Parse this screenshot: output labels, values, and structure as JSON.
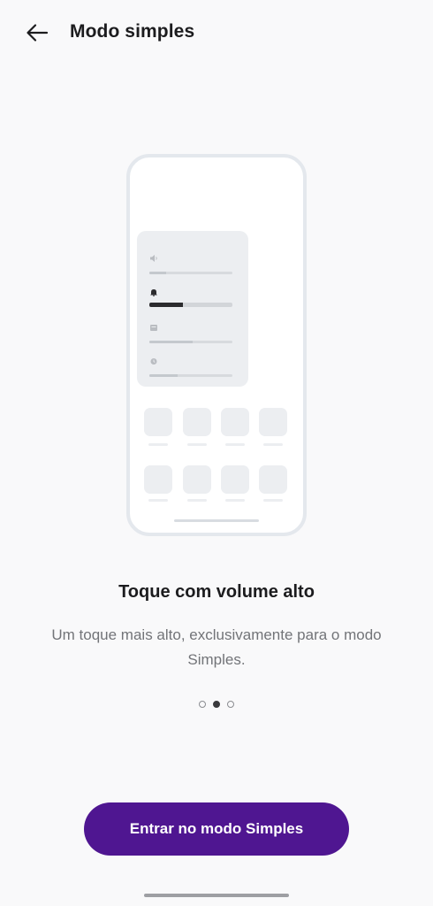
{
  "header": {
    "back_icon": "arrow-left-icon",
    "title": "Modo simples"
  },
  "illustration": {
    "volume_sliders": [
      {
        "icon": "speaker-icon",
        "level": 0.2
      },
      {
        "icon": "bell-icon",
        "level": 0.4,
        "active": true
      },
      {
        "icon": "notification-icon",
        "level": 0.52
      },
      {
        "icon": "alarm-clock-icon",
        "level": 0.34
      }
    ],
    "app_rows": 2,
    "apps_per_row": 4
  },
  "slide": {
    "title": "Toque com volume alto",
    "description": "Um toque mais alto, exclusivamente para o modo Simples."
  },
  "pager": {
    "count": 3,
    "active_index": 1
  },
  "cta": {
    "label": "Entrar no modo Simples"
  },
  "colors": {
    "accent": "#4f1691",
    "background": "#f9f9fa"
  }
}
